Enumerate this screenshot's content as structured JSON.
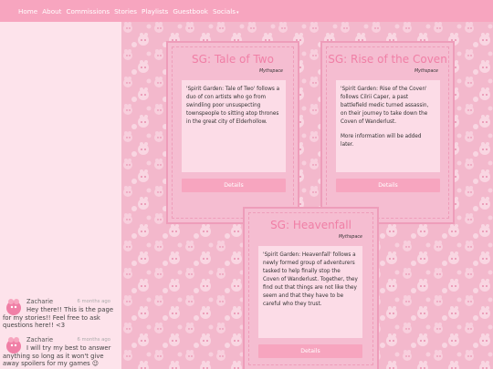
{
  "nav": {
    "items": [
      "Home",
      "About",
      "Commissions",
      "Stories",
      "Playlists",
      "Guestbook",
      "Socials"
    ],
    "socials_caret": "▾"
  },
  "sidebar": {
    "messages": [
      {
        "name": "Zacharie",
        "time": "6 months ago",
        "text": "Hey there!! This is the page for my stories!! Feel free to ask questions here!! <3"
      },
      {
        "name": "Zacharie",
        "time": "6 months ago",
        "text": "I will try my best to answer anything so long as it won't give away spoilers for my games 😉"
      }
    ]
  },
  "stories": [
    {
      "title": "SG: Tale of Two",
      "publisher": "Mythspace",
      "description": [
        "'Spirit Garden: Tale of Two' follows a duo of con artists who go from swindling poor unsuspecting townspeople to sitting atop thrones in the great city of Elderhollow."
      ],
      "button": "Details"
    },
    {
      "title": "SG: Rise of the Coven",
      "publisher": "Mythspace",
      "description": [
        "'Spirit Garden: Rise of the Coven' follows Cilrii Caper, a past battlefield medic turned assassin, on their journey to take down the Coven of Wanderlust.",
        "More information will be added later."
      ],
      "button": "Details"
    },
    {
      "title": "SG: Heavenfall",
      "publisher": "Mythspace",
      "description": [
        "'Spirit Garden: Heavenfall' follows a newly formed group of adventurers tasked to help finally stop the Coven of Wanderlust. Together, they find out that things are not like they seem and that they have to be careful who they trust."
      ],
      "button": "Details"
    }
  ],
  "colors": {
    "nav": "#f7a5bf",
    "accent": "#f07fa6",
    "card": "#f5bdd1",
    "panel": "#fcdce7",
    "pattern": "#f3b8cc"
  }
}
